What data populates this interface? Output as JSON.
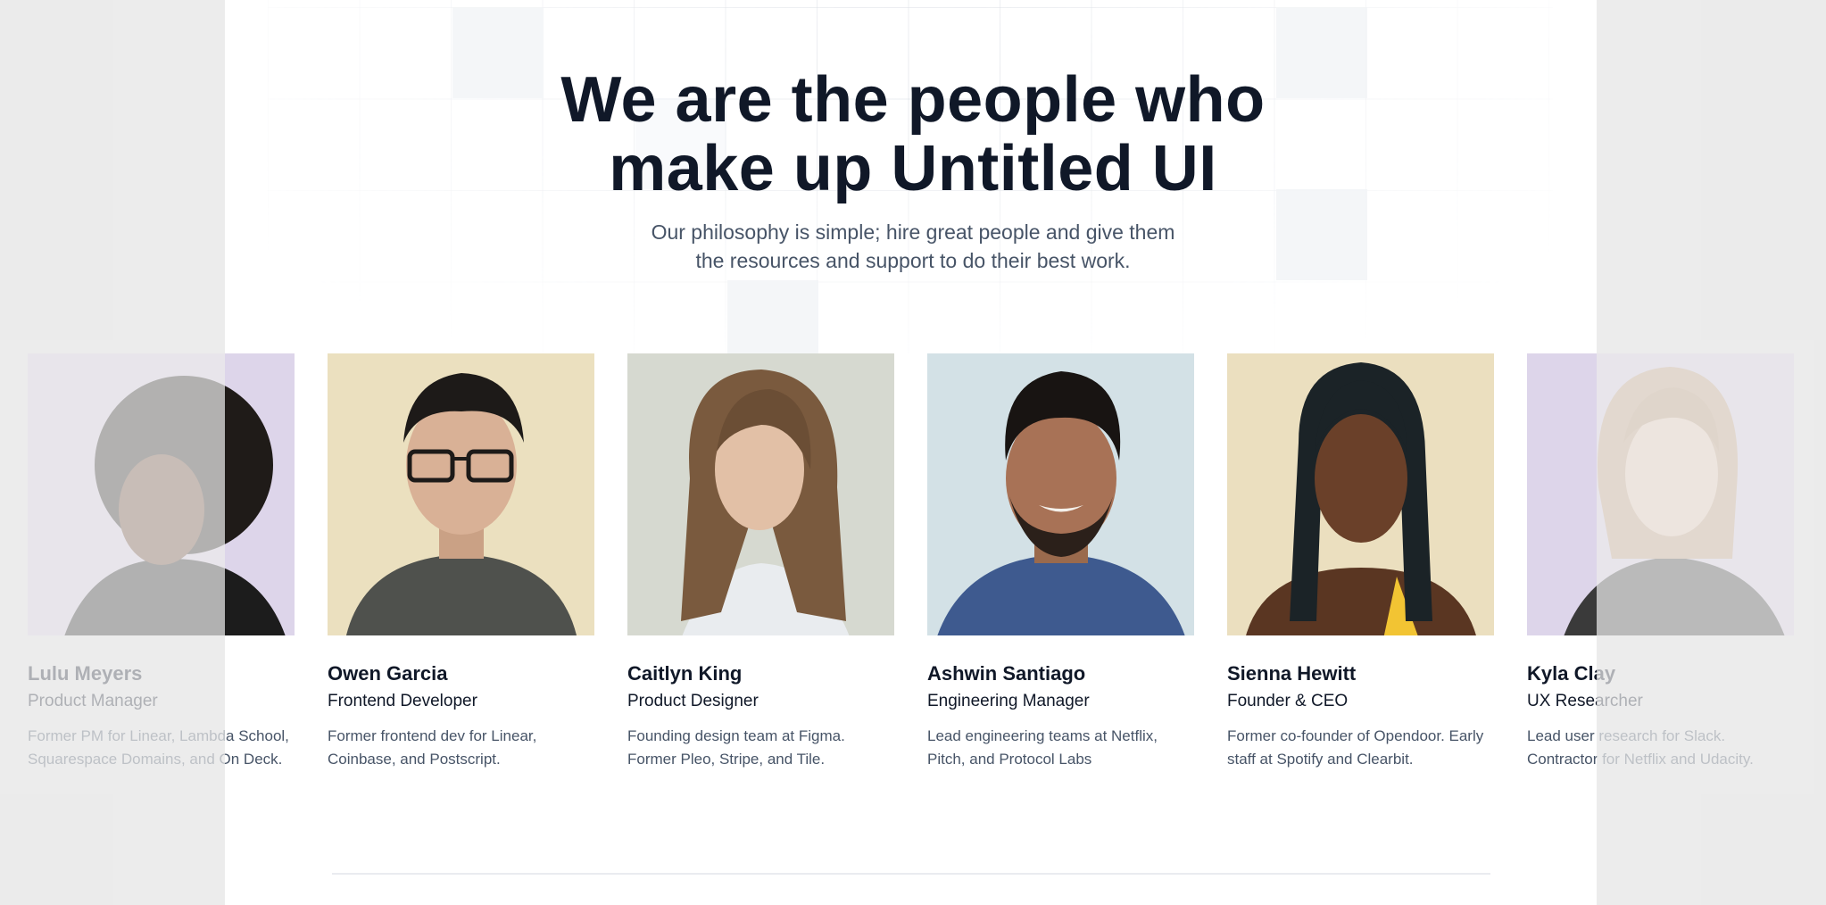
{
  "hero": {
    "title_line1": "We are the people who",
    "title_line2": "make up Untitled UI",
    "subtitle_line1": "Our philosophy is simple; hire great people and give them",
    "subtitle_line2": "the resources and support to do their best work."
  },
  "team": [
    {
      "name": "Lulu Meyers",
      "role": "Product Manager",
      "bio": "Former PM for Linear, Lambda School, Squarespace Domains, and On Deck.",
      "photo_bg": "#ddd5ea"
    },
    {
      "name": "Owen Garcia",
      "role": "Frontend Developer",
      "bio": "Former frontend dev for Linear, Coinbase, and Postscript.",
      "photo_bg": "#ebe0bf"
    },
    {
      "name": "Caitlyn King",
      "role": "Product Designer",
      "bio": "Founding design team at Figma. Former Pleo, Stripe, and Tile.",
      "photo_bg": "#d6d9d0"
    },
    {
      "name": "Ashwin Santiago",
      "role": "Engineering Manager",
      "bio": "Lead engineering teams at Netflix, Pitch, and Protocol Labs",
      "photo_bg": "#d3e1e6"
    },
    {
      "name": "Sienna Hewitt",
      "role": "Founder & CEO",
      "bio": "Former co-founder of Opendoor. Early staff at Spotify and Clearbit.",
      "photo_bg": "#ebdfbf"
    },
    {
      "name": "Kyla Clay",
      "role": "UX Researcher",
      "bio": "Lead user research for Slack. Contractor for Netflix and Udacity.",
      "photo_bg": "#ddd5ea"
    }
  ],
  "colors": {
    "text_primary": "#101828",
    "text_secondary": "#475467",
    "page_bg": "#ffffff",
    "outer_bg": "#ebebeb"
  }
}
